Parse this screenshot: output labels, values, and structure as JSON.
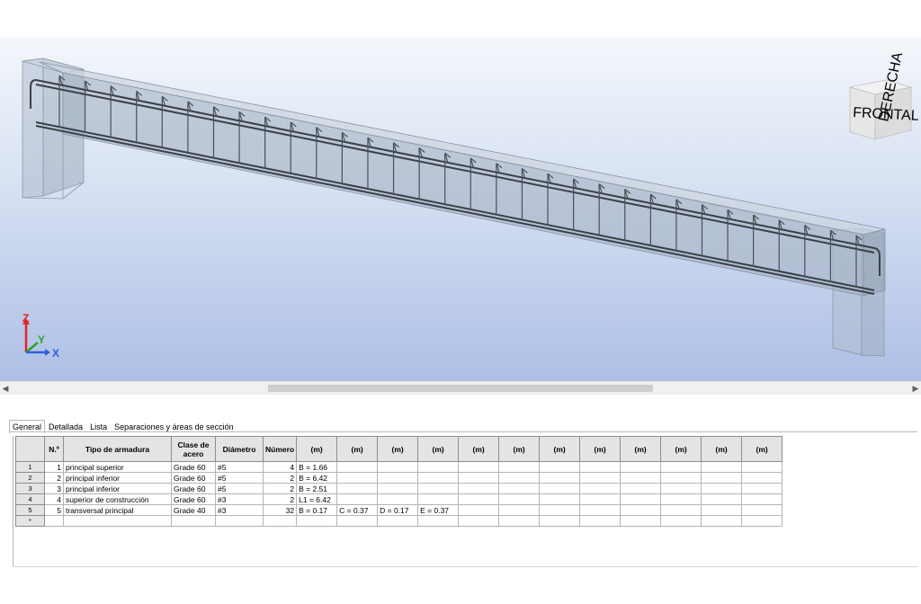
{
  "viewport": {
    "view_cube": {
      "front_label": "FRONTAL",
      "right_label": "DERECHA"
    },
    "axes": {
      "z": "Z",
      "y": "Y",
      "x": "X"
    },
    "colors": {
      "x_axis": "#2f5fd6",
      "y_axis": "#2ea02e",
      "z_axis": "#e02424"
    }
  },
  "tabs": [
    {
      "label": "General",
      "active": true
    },
    {
      "label": "Detallada",
      "active": false
    },
    {
      "label": "Lista",
      "active": false
    },
    {
      "label": "Separaciones y áreas de sección",
      "active": false
    }
  ],
  "table": {
    "headers": {
      "n": "N.º",
      "tipo": "Tipo de armadura",
      "clase": "Clase de acero",
      "diametro": "Diámetro",
      "numero": "Número",
      "m1": "(m)",
      "m2": "(m)",
      "m3": "(m)",
      "m4": "(m)",
      "m5": "(m)",
      "m6": "(m)",
      "m7": "(m)",
      "m8": "(m)",
      "m9": "(m)",
      "m10": "(m)",
      "m11": "(m)",
      "m12": "(m)"
    },
    "rows": [
      {
        "idx": "1",
        "n": "1",
        "tipo": "principal superior",
        "clase": "Grade 60",
        "diametro": "#5",
        "numero": "4",
        "m1": "B = 1.66",
        "m2": "",
        "m3": "",
        "m4": ""
      },
      {
        "idx": "2",
        "n": "2",
        "tipo": "principal inferior",
        "clase": "Grade 60",
        "diametro": "#5",
        "numero": "2",
        "m1": "B = 6.42",
        "m2": "",
        "m3": "",
        "m4": ""
      },
      {
        "idx": "3",
        "n": "3",
        "tipo": "principal inferior",
        "clase": "Grade 60",
        "diametro": "#5",
        "numero": "2",
        "m1": "B = 2.51",
        "m2": "",
        "m3": "",
        "m4": ""
      },
      {
        "idx": "4",
        "n": "4",
        "tipo": "superior de construcción",
        "clase": "Grade 60",
        "diametro": "#3",
        "numero": "2",
        "m1": "L1 = 6.42",
        "m2": "",
        "m3": "",
        "m4": ""
      },
      {
        "idx": "5",
        "n": "5",
        "tipo": "transversal principal",
        "clase": "Grade 40",
        "diametro": "#3",
        "numero": "32",
        "m1": "B = 0.17",
        "m2": "C = 0.37",
        "m3": "D = 0.17",
        "m4": "E = 0.37"
      }
    ],
    "new_row_marker": "*"
  }
}
